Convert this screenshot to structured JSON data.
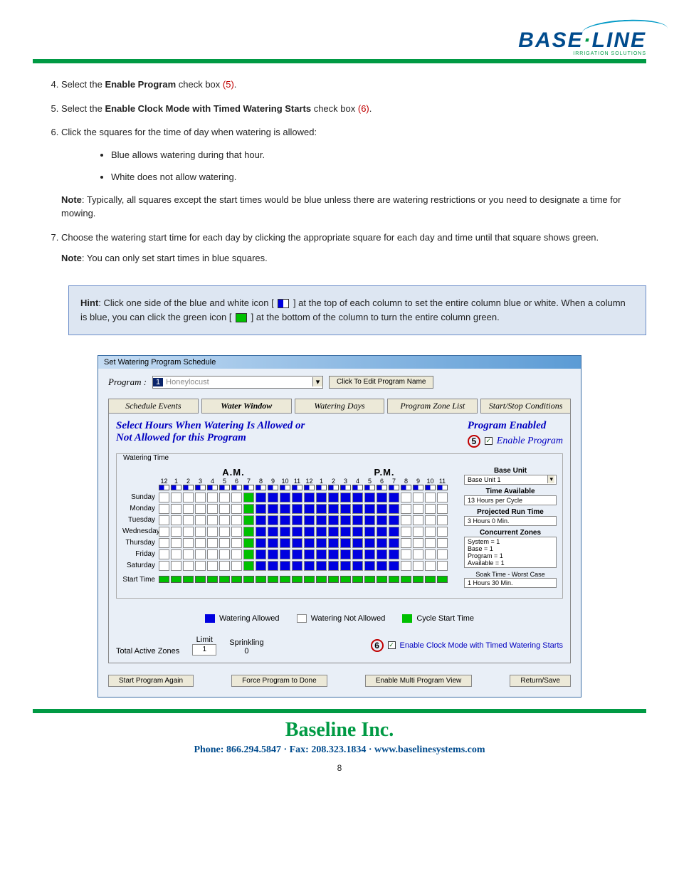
{
  "logo": {
    "brand": "BASE",
    "dot": "·",
    "brand2": "LINE",
    "sub": "IRRIGATION SOLUTIONS"
  },
  "steps": {
    "s4": {
      "pre": "Select the ",
      "b": "Enable Program",
      "post": " check box ",
      "ref": "(5)",
      "tail": "."
    },
    "s5": {
      "pre": "Select the ",
      "b": "Enable Clock Mode with Timed Watering Starts",
      "post": " check box ",
      "ref": "(6)",
      "tail": "."
    },
    "s6": {
      "text": "Click the squares for the time of day when watering is allowed:",
      "bullets": [
        "Blue allows watering during that hour.",
        "White does not allow watering."
      ],
      "note_b": "Note",
      "note": ": Typically, all squares except the start times would be blue unless there are watering restrictions or you need to designate a time for mowing."
    },
    "s7": {
      "text": "Choose the watering start time for each day by clicking the appropriate square for each day and time until that square shows green.",
      "note_b": "Note",
      "note": ": You can only set start times in blue squares."
    }
  },
  "hint": {
    "b": "Hint",
    "t1": ": Click one side of the blue and white icon [ ",
    "t2": " ] at the top of each column to set the entire column blue or white. When a column is blue, you can click the green icon [ ",
    "t3": " ] at the bottom of the column to turn the entire column green."
  },
  "dialog": {
    "title": "Set Watering Program Schedule",
    "program_label": "Program :",
    "program_num": "1",
    "program_name": "Honeylocust",
    "edit_name_btn": "Click To Edit Program Name",
    "tabs": [
      "Schedule Events",
      "Water Window",
      "Watering Days",
      "Program Zone List",
      "Start/Stop Conditions"
    ],
    "instr1": "Select Hours When Watering Is Allowed or",
    "instr2": "Not Allowed for this Program",
    "enabled_hdr": "Program Enabled",
    "enable_prog_lbl": "Enable Program",
    "callout5": "5",
    "fs_label": "Watering Time",
    "am": "A.M.",
    "pm": "P.M.",
    "hours": [
      "12",
      "1",
      "2",
      "3",
      "4",
      "5",
      "6",
      "7",
      "8",
      "9",
      "10",
      "11",
      "12",
      "1",
      "2",
      "3",
      "4",
      "5",
      "6",
      "7",
      "8",
      "9",
      "10",
      "11"
    ],
    "days": [
      "Sunday",
      "Monday",
      "Tuesday",
      "Wednesday",
      "Thursday",
      "Friday",
      "Saturday"
    ],
    "start_time_lbl": "Start Time",
    "side": {
      "base_unit_hdr": "Base Unit",
      "base_unit_val": "Base Unit 1",
      "time_avail_hdr": "Time Available",
      "time_avail_val": "13 Hours per Cycle",
      "proj_hdr": "Projected Run Time",
      "proj_val": "3 Hours   0 Min.",
      "conc_hdr": "Concurrent Zones",
      "conc_lines": [
        "System = 1",
        "Base = 1",
        "Program = 1",
        "Available  = 1"
      ],
      "soak_hdr": "Soak Time - Worst Case",
      "soak_val": "1 Hours   30 Min."
    },
    "legend": {
      "a": "Watering Allowed",
      "b": "Watering Not Allowed",
      "c": "Cycle Start Time"
    },
    "zones": {
      "label": "Total Active Zones",
      "limit_hdr": "Limit",
      "limit_val": "1",
      "spr_hdr": "Sprinkling",
      "spr_val": "0"
    },
    "callout6": "6",
    "clock_lbl": "Enable Clock Mode with Timed Watering Starts",
    "buttons": [
      "Start Program Again",
      "Force Program to Done",
      "Enable Multi Program View",
      "Return/Save"
    ]
  },
  "footer": {
    "name": "Baseline Inc.",
    "contact": "Phone:  866.294.5847  ·  Fax:  208.323.1834  ·  www.baselinesystems.com",
    "page": "8"
  },
  "chart_data": {
    "type": "table",
    "title": "Watering Time grid — hours allowed (blue), start (green), not allowed (white)",
    "columns_am": [
      12,
      1,
      2,
      3,
      4,
      5,
      6,
      7,
      8,
      9,
      10,
      11
    ],
    "columns_pm": [
      12,
      1,
      2,
      3,
      4,
      5,
      6,
      7,
      8,
      9,
      10,
      11
    ],
    "rows": [
      "Sunday",
      "Monday",
      "Tuesday",
      "Wednesday",
      "Thursday",
      "Friday",
      "Saturday"
    ],
    "legend": {
      "0": "Not Allowed (white)",
      "1": "Watering Allowed (blue)",
      "2": "Cycle Start Time (green)"
    },
    "values": [
      [
        0,
        0,
        0,
        0,
        0,
        0,
        0,
        2,
        1,
        1,
        1,
        1,
        1,
        1,
        1,
        1,
        1,
        1,
        1,
        1,
        0,
        0,
        0,
        0
      ],
      [
        0,
        0,
        0,
        0,
        0,
        0,
        0,
        2,
        1,
        1,
        1,
        1,
        1,
        1,
        1,
        1,
        1,
        1,
        1,
        1,
        0,
        0,
        0,
        0
      ],
      [
        0,
        0,
        0,
        0,
        0,
        0,
        0,
        2,
        1,
        1,
        1,
        1,
        1,
        1,
        1,
        1,
        1,
        1,
        1,
        1,
        0,
        0,
        0,
        0
      ],
      [
        0,
        0,
        0,
        0,
        0,
        0,
        0,
        2,
        1,
        1,
        1,
        1,
        1,
        1,
        1,
        1,
        1,
        1,
        1,
        1,
        0,
        0,
        0,
        0
      ],
      [
        0,
        0,
        0,
        0,
        0,
        0,
        0,
        2,
        1,
        1,
        1,
        1,
        1,
        1,
        1,
        1,
        1,
        1,
        1,
        1,
        0,
        0,
        0,
        0
      ],
      [
        0,
        0,
        0,
        0,
        0,
        0,
        0,
        2,
        1,
        1,
        1,
        1,
        1,
        1,
        1,
        1,
        1,
        1,
        1,
        1,
        0,
        0,
        0,
        0
      ],
      [
        0,
        0,
        0,
        0,
        0,
        0,
        0,
        2,
        1,
        1,
        1,
        1,
        1,
        1,
        1,
        1,
        1,
        1,
        1,
        1,
        0,
        0,
        0,
        0
      ]
    ]
  }
}
